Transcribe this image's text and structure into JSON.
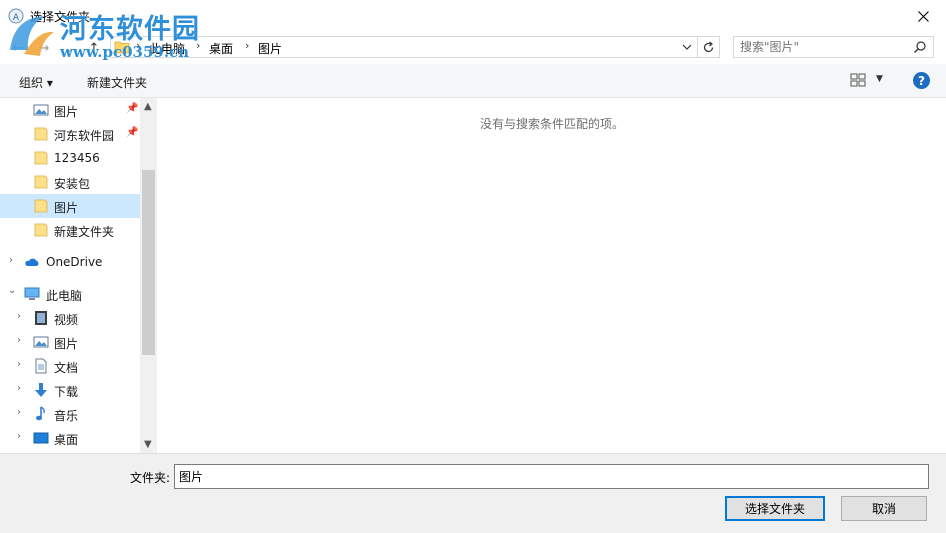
{
  "window": {
    "title": "选择文件夹",
    "close_glyph": "✕"
  },
  "watermark": {
    "title": "河东软件园",
    "url": "www.pc0359.cn"
  },
  "nav": {
    "back_glyph": "←",
    "forward_glyph": "→",
    "recent_glyph": "⌄",
    "up_glyph": "↑",
    "breadcrumb": [
      "此电脑",
      "桌面",
      "图片"
    ],
    "separator": "›",
    "search_placeholder": "搜索\"图片\""
  },
  "toolbar": {
    "organize": "组织 ▾",
    "new_folder": "新建文件夹",
    "help": "?"
  },
  "tree": {
    "items": [
      {
        "label": "图片",
        "pinned": true
      },
      {
        "label": "河东软件园",
        "pinned": true
      },
      {
        "label": "123456"
      },
      {
        "label": "安装包"
      },
      {
        "label": "图片",
        "selected": true
      },
      {
        "label": "新建文件夹"
      },
      {
        "label": "OneDrive"
      },
      {
        "label": "此电脑"
      },
      {
        "label": "视频"
      },
      {
        "label": "图片"
      },
      {
        "label": "文档"
      },
      {
        "label": "下载"
      },
      {
        "label": "音乐"
      },
      {
        "label": "桌面"
      }
    ],
    "chev_right": "›",
    "chev_down": "⌄",
    "pin_glyph": "✎"
  },
  "content": {
    "empty_message": "没有与搜索条件匹配的项。"
  },
  "bottom": {
    "folder_label": "文件夹:",
    "folder_value": "图片",
    "select_button": "选择文件夹",
    "cancel_button": "取消"
  },
  "colors": {
    "selection": "#cce8ff",
    "accent": "#0078d7",
    "help": "#1c6cc4",
    "watermark": "#2f8fd8"
  }
}
